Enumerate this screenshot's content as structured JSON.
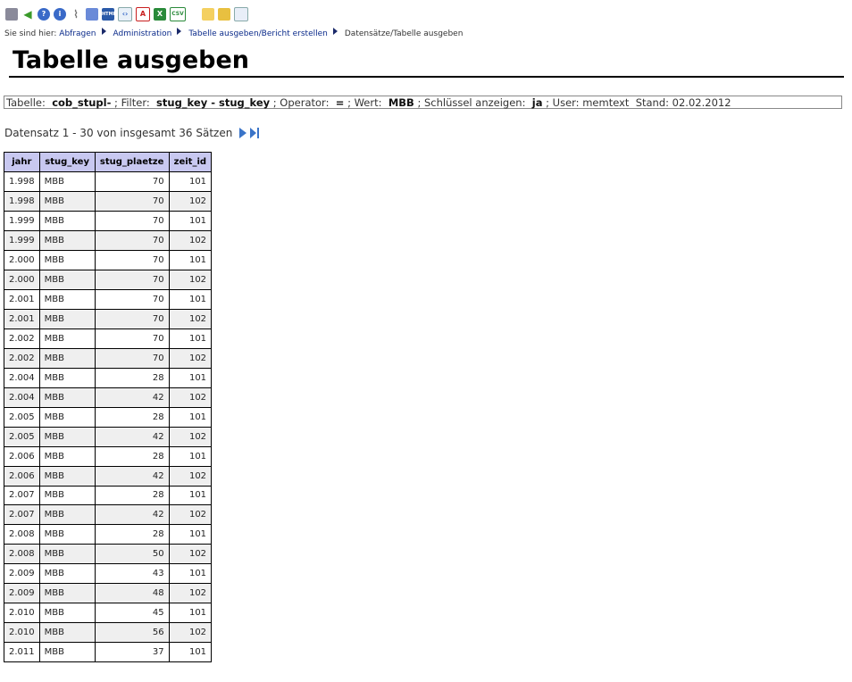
{
  "toolbar": {
    "icons": [
      "printer-icon",
      "back-arrow-icon",
      "help-icon",
      "info-icon",
      "paperclip-icon",
      "table-icon",
      "html-icon",
      "xml-icon",
      "pdf-icon",
      "excel-icon",
      "csv-icon",
      "edit-icon",
      "folder-open-icon",
      "edit-form-icon"
    ],
    "html_label": "HTML",
    "csv_label": "CSV"
  },
  "breadcrumb": {
    "prefix": "Sie sind hier:",
    "items": [
      "Abfragen",
      "Administration",
      "Tabelle ausgeben/Bericht erstellen",
      "Datensätze/Tabelle ausgeben"
    ]
  },
  "page": {
    "title": "Tabelle ausgeben"
  },
  "info": {
    "tabelle_label": "Tabelle:",
    "tabelle_value": "cob_stupl-",
    "filter_label": "; Filter:",
    "filter_value": "stug_key - stug_key",
    "operator_label": "; Operator:",
    "operator_value": "=",
    "wert_label": "; Wert:",
    "wert_value": "MBB",
    "schluessel_label": "; Schlüssel anzeigen:",
    "schluessel_value": "ja",
    "user_label": "; User: memtext",
    "stand": "Stand: 02.02.2012"
  },
  "pager": {
    "text": "Datensatz 1 - 30 von insgesamt 36 Sätzen"
  },
  "table": {
    "columns": [
      "jahr",
      "stug_key",
      "stug_plaetze",
      "zeit_id"
    ],
    "rows": [
      [
        "1.998",
        "MBB",
        "70",
        "101"
      ],
      [
        "1.998",
        "MBB",
        "70",
        "102"
      ],
      [
        "1.999",
        "MBB",
        "70",
        "101"
      ],
      [
        "1.999",
        "MBB",
        "70",
        "102"
      ],
      [
        "2.000",
        "MBB",
        "70",
        "101"
      ],
      [
        "2.000",
        "MBB",
        "70",
        "102"
      ],
      [
        "2.001",
        "MBB",
        "70",
        "101"
      ],
      [
        "2.001",
        "MBB",
        "70",
        "102"
      ],
      [
        "2.002",
        "MBB",
        "70",
        "101"
      ],
      [
        "2.002",
        "MBB",
        "70",
        "102"
      ],
      [
        "2.004",
        "MBB",
        "28",
        "101"
      ],
      [
        "2.004",
        "MBB",
        "42",
        "102"
      ],
      [
        "2.005",
        "MBB",
        "28",
        "101"
      ],
      [
        "2.005",
        "MBB",
        "42",
        "102"
      ],
      [
        "2.006",
        "MBB",
        "28",
        "101"
      ],
      [
        "2.006",
        "MBB",
        "42",
        "102"
      ],
      [
        "2.007",
        "MBB",
        "28",
        "101"
      ],
      [
        "2.007",
        "MBB",
        "42",
        "102"
      ],
      [
        "2.008",
        "MBB",
        "28",
        "101"
      ],
      [
        "2.008",
        "MBB",
        "50",
        "102"
      ],
      [
        "2.009",
        "MBB",
        "43",
        "101"
      ],
      [
        "2.009",
        "MBB",
        "48",
        "102"
      ],
      [
        "2.010",
        "MBB",
        "45",
        "101"
      ],
      [
        "2.010",
        "MBB",
        "56",
        "102"
      ],
      [
        "2.011",
        "MBB",
        "37",
        "101"
      ]
    ]
  }
}
